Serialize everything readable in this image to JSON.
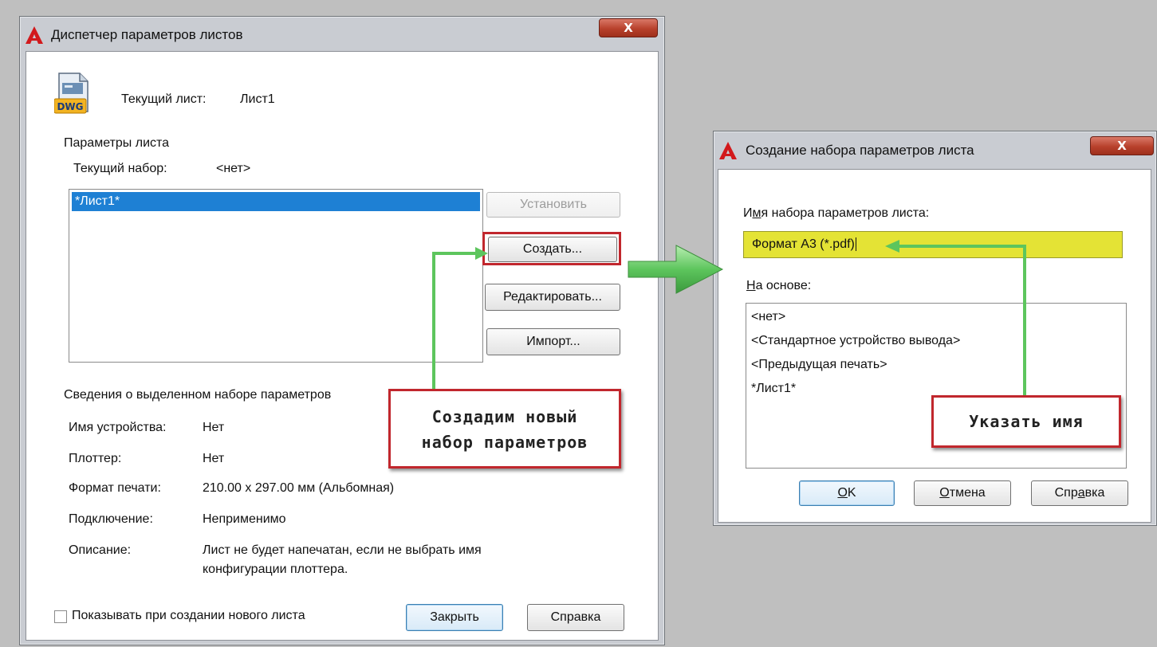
{
  "page_manager": {
    "title": "Диспетчер параметров листов",
    "close_label": "X",
    "dwg_badge": "DWG",
    "current_sheet_label": "Текущий лист:",
    "current_sheet_value": "Лист1",
    "params_group_label": "Параметры листа",
    "current_set_label": "Текущий набор:",
    "current_set_value": "<нет>",
    "list_items": [
      "*Лист1*"
    ],
    "buttons": {
      "set": "Установить",
      "create": "Создать...",
      "edit": "Редактировать...",
      "import": "Импорт..."
    },
    "details_group_label": "Сведения о выделенном наборе параметров",
    "details": {
      "device_name_label": "Имя устройства:",
      "device_name_value": "Нет",
      "plotter_label": "Плоттер:",
      "plotter_value": "Нет",
      "paper_size_label": "Формат печати:",
      "paper_size_value": "210.00 x 297.00 мм (Альбомная)",
      "connection_label": "Подключение:",
      "connection_value": "Неприменимо",
      "description_label": "Описание:",
      "description_line1": "Лист не будет напечатан, если не выбрать имя",
      "description_line2": "конфигурации плоттера."
    },
    "show_on_create_label": "Показывать при создании нового листа",
    "close_button": "Закрыть",
    "help_button": "Справка"
  },
  "new_set_dialog": {
    "title": "Создание набора параметров листа",
    "close_label": "X",
    "name_label_pre": "И",
    "name_label_ul": "м",
    "name_label_post": "я набора параметров листа:",
    "name_value": "Формат А3 (*.pdf)",
    "based_on_ul": "Н",
    "based_on_post": "а основе:",
    "based_on_items": [
      "<нет>",
      "<Стандартное устройство вывода>",
      "<Предыдущая печать>",
      "*Лист1*"
    ],
    "ok_ul": "O",
    "ok_post": "K",
    "cancel_ul": "О",
    "cancel_post": "тмена",
    "help_pre": "Спр",
    "help_ul": "а",
    "help_post": "вка"
  },
  "annotations": {
    "callout_create_line1": "Создадим новый",
    "callout_create_line2": "набор параметров",
    "callout_name": "Указать имя"
  },
  "colors": {
    "highlight_red": "#c1272d",
    "arrow_green": "#5dc55d",
    "name_field_yellow": "#e4e335",
    "selection_blue": "#1e80d4"
  }
}
